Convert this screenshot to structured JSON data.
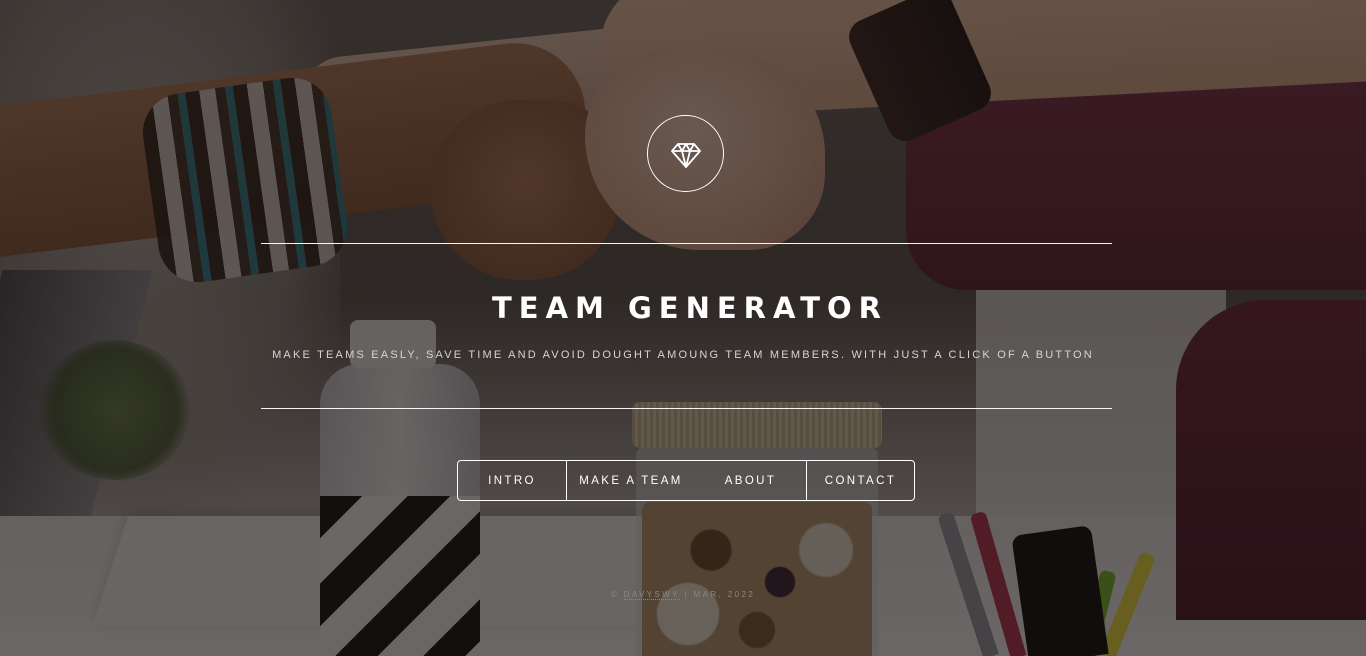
{
  "site": {
    "title": "TEAM GENERATOR",
    "subtitle": "MAKE TEAMS EASLY, SAVE TIME AND AVOID DOUGHT AMOUNG TEAM MEMBERS. WITH JUST A CLICK OF A BUTTON",
    "logo_icon": "diamond-icon"
  },
  "nav": {
    "items": [
      {
        "label": "INTRO"
      },
      {
        "label": "MAKE A TEAM"
      },
      {
        "label": "ABOUT"
      },
      {
        "label": "CONTACT"
      }
    ]
  },
  "footer": {
    "prefix": "© ",
    "author": "DAVYSWY",
    "separator": " | ",
    "date": "MAR, 2022"
  },
  "colors": {
    "overlay": "#130f0f",
    "text": "#ffffff",
    "muted": "#8d8784"
  }
}
